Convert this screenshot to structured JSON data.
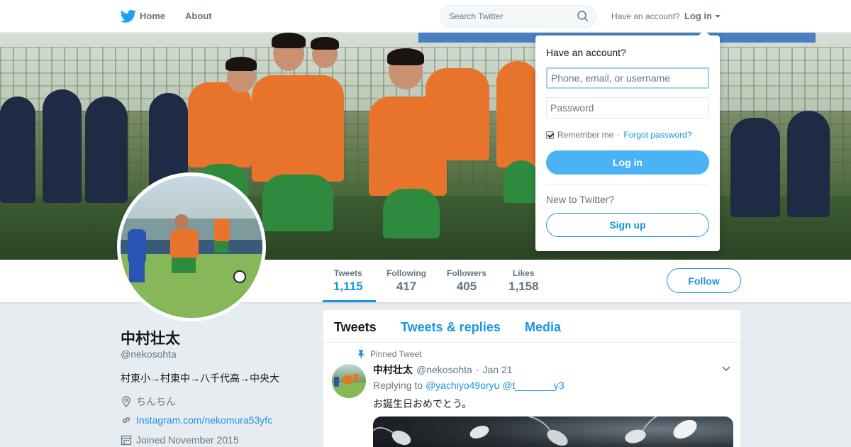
{
  "topnav": {
    "home_label": "Home",
    "about_label": "About",
    "search_placeholder": "Search Twitter",
    "have_account": "Have an account?",
    "login_label": "Log in"
  },
  "login_dropdown": {
    "title": "Have an account?",
    "username_placeholder": "Phone, email, or username",
    "password_placeholder": "Password",
    "remember_label": "Remember me",
    "separator": "·",
    "forgot_label": "Forgot password?",
    "login_button": "Log in",
    "new_label": "New to Twitter?",
    "signup_button": "Sign up"
  },
  "profile_nav": {
    "stats": [
      {
        "label": "Tweets",
        "value": "1,115"
      },
      {
        "label": "Following",
        "value": "417"
      },
      {
        "label": "Followers",
        "value": "405"
      },
      {
        "label": "Likes",
        "value": "1,158"
      }
    ],
    "follow_button": "Follow"
  },
  "profile": {
    "name": "中村壮太",
    "handle": "@nekosohta",
    "bio": "村東小→村東中→八千代高→中央大",
    "location": "ちんちん",
    "link": "Instagram.com/nekomura53yfc",
    "joined": "Joined November 2015"
  },
  "timeline": {
    "tabs": [
      "Tweets",
      "Tweets & replies",
      "Media"
    ],
    "pinned_label": "Pinned Tweet",
    "tweet": {
      "name": "中村壮太",
      "handle": "@nekosohta",
      "separator": "·",
      "date": "Jan 21",
      "replying_prefix": "Replying to",
      "mention1": "@yachiyo49oryu",
      "mention2": "@t_______y3",
      "text": "お誕生日おめでとう。"
    }
  },
  "colors": {
    "brand_blue": "#1da1f2",
    "link_blue": "#1b95e0",
    "login_button": "#4ab3f4",
    "jersey_orange": "#e8742c",
    "shorts_green": "#2e8b3e"
  }
}
